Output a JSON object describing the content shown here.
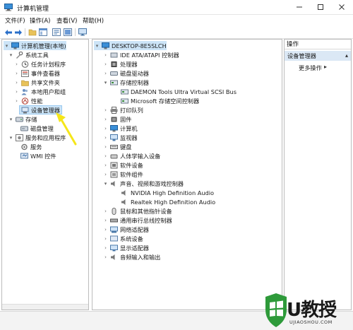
{
  "window": {
    "title": "计算机管理"
  },
  "menu": [
    "文件(F)",
    "操作(A)",
    "查看(V)",
    "帮助(H)"
  ],
  "toolbar_icons": [
    "back-arrow-icon",
    "forward-arrow-icon",
    "folder-up-icon",
    "console-tree-icon",
    "properties-icon",
    "help-icon",
    "monitor-icon"
  ],
  "left_tree": {
    "root": "计算机管理(本地)",
    "items": [
      {
        "label": "系统工具",
        "icon": "tools-icon"
      },
      {
        "label": "任务计划程序",
        "icon": "clock-icon"
      },
      {
        "label": "事件查看器",
        "icon": "event-viewer-icon"
      },
      {
        "label": "共享文件夹",
        "icon": "shared-folder-icon"
      },
      {
        "label": "本地用户和组",
        "icon": "users-icon"
      },
      {
        "label": "性能",
        "icon": "performance-icon"
      },
      {
        "label": "设备管理器",
        "icon": "device-manager-icon"
      },
      {
        "label": "存储",
        "icon": "storage-icon"
      },
      {
        "label": "磁盘管理",
        "icon": "disk-icon"
      },
      {
        "label": "服务和应用程序",
        "icon": "services-apps-icon"
      },
      {
        "label": "服务",
        "icon": "services-icon"
      },
      {
        "label": "WMI 控件",
        "icon": "wmi-icon"
      }
    ]
  },
  "device_tree": {
    "root": "DESKTOP-8E5SLCH",
    "items": [
      {
        "label": "IDE ATA/ATAPI 控制器",
        "icon": "ide-icon"
      },
      {
        "label": "处理器",
        "icon": "cpu-icon"
      },
      {
        "label": "磁盘驱动器",
        "icon": "disk-drive-icon"
      },
      {
        "label": "存储控制器",
        "icon": "storage-controller-icon"
      },
      {
        "label": "DAEMON Tools Ultra Virtual SCSI Bus",
        "icon": "storage-controller-icon"
      },
      {
        "label": "Microsoft 存储空间控制器",
        "icon": "storage-controller-icon"
      },
      {
        "label": "打印队列",
        "icon": "printer-icon"
      },
      {
        "label": "固件",
        "icon": "firmware-icon"
      },
      {
        "label": "计算机",
        "icon": "computer-icon"
      },
      {
        "label": "监视器",
        "icon": "monitor-icon"
      },
      {
        "label": "键盘",
        "icon": "keyboard-icon"
      },
      {
        "label": "人体学输入设备",
        "icon": "hid-icon"
      },
      {
        "label": "软件设备",
        "icon": "software-device-icon"
      },
      {
        "label": "软件组件",
        "icon": "software-component-icon"
      },
      {
        "label": "声音、视频和游戏控制器",
        "icon": "speaker-icon"
      },
      {
        "label": "NVIDIA High Definition Audio",
        "icon": "speaker-icon"
      },
      {
        "label": "Realtek High Definition Audio",
        "icon": "speaker-icon"
      },
      {
        "label": "鼠标和其他指针设备",
        "icon": "mouse-icon"
      },
      {
        "label": "通用串行总线控制器",
        "icon": "usb-icon"
      },
      {
        "label": "网络适配器",
        "icon": "network-icon"
      },
      {
        "label": "系统设备",
        "icon": "system-device-icon"
      },
      {
        "label": "显示适配器",
        "icon": "display-adapter-icon"
      },
      {
        "label": "音频输入和输出",
        "icon": "audio-io-icon"
      }
    ]
  },
  "actions": {
    "header": "操作",
    "section": "设备管理器",
    "more": "更多操作"
  },
  "watermark": {
    "text": "U教授",
    "sub": "UJIAOSHOU.COM"
  },
  "colors": {
    "selection": "#cce4f7",
    "selection_border": "#99c9ef",
    "action_section": "#dbe8f5",
    "annotation_arrow": "#f5e61a",
    "logo_green": "#2e9a3a"
  }
}
